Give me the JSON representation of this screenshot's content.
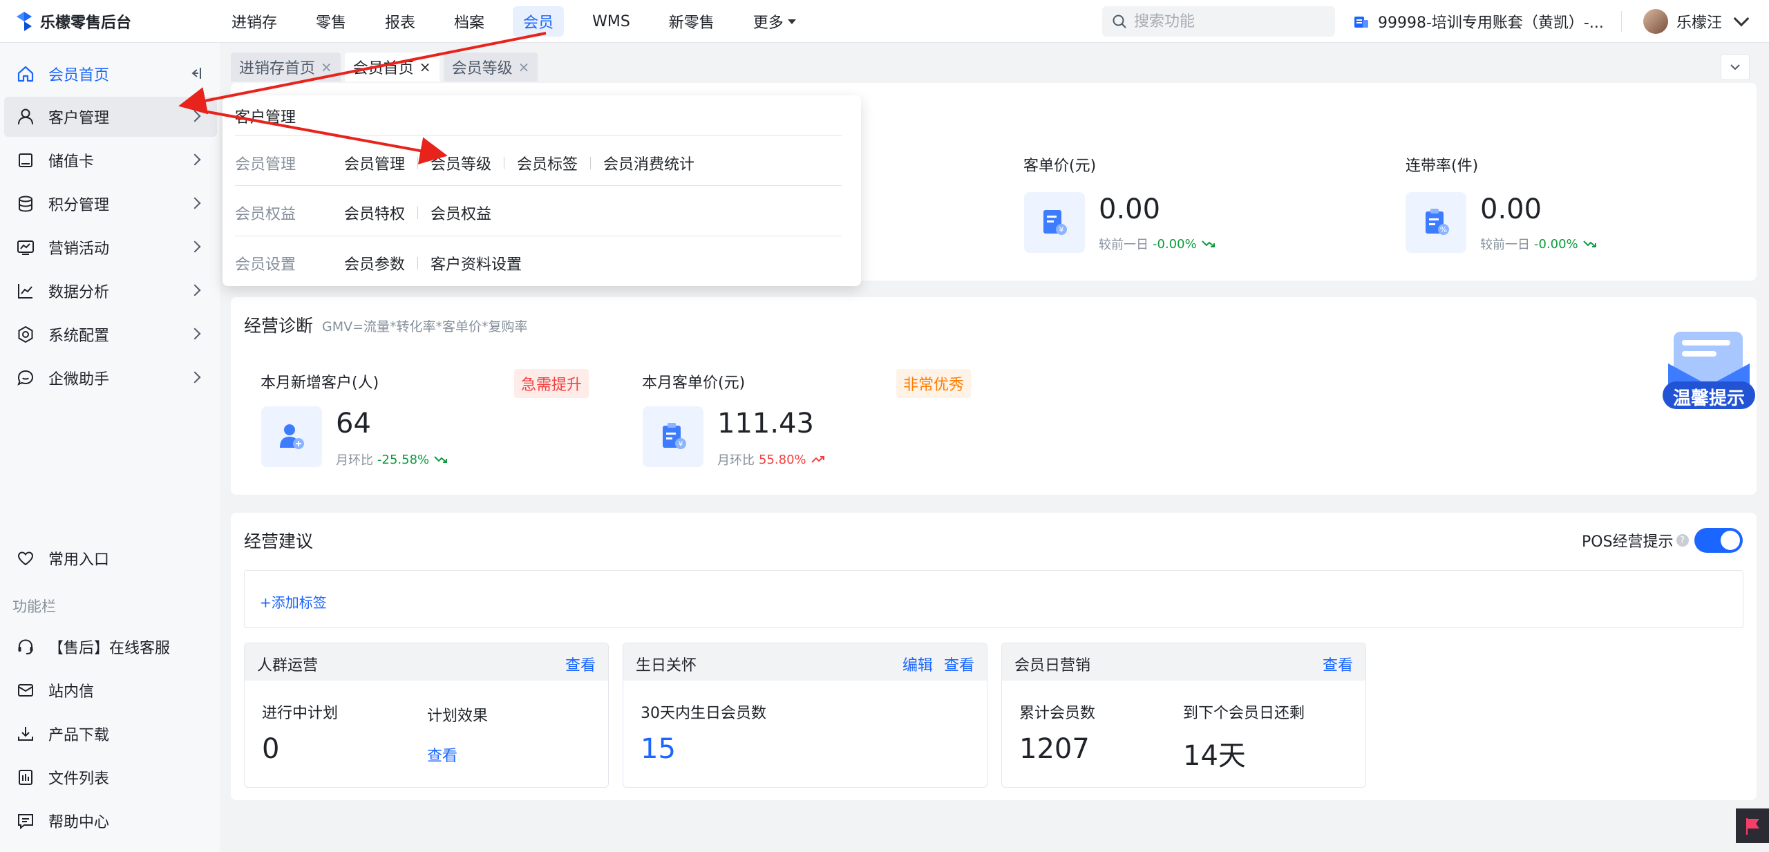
{
  "app": {
    "logo_text": "乐檬零售后台"
  },
  "nav": {
    "items": [
      {
        "label": "进销存",
        "active": false
      },
      {
        "label": "零售",
        "active": false
      },
      {
        "label": "报表",
        "active": false
      },
      {
        "label": "档案",
        "active": false
      },
      {
        "label": "会员",
        "active": true
      },
      {
        "label": "WMS",
        "active": false
      },
      {
        "label": "新零售",
        "active": false
      },
      {
        "label": "更多",
        "active": false
      }
    ]
  },
  "search": {
    "placeholder": "搜索功能"
  },
  "account": {
    "label": "99998-培训专用账套（黄凯）-..."
  },
  "user": {
    "name": "乐檬汪"
  },
  "sidebar": {
    "items": [
      {
        "label": "会员首页"
      },
      {
        "label": "客户管理"
      },
      {
        "label": "储值卡"
      },
      {
        "label": "积分管理"
      },
      {
        "label": "营销活动"
      },
      {
        "label": "数据分析"
      },
      {
        "label": "系统配置"
      },
      {
        "label": "企微助手"
      }
    ],
    "favorites": "常用入口",
    "section_label": "功能栏",
    "tools": [
      {
        "label": "【售后】在线客服"
      },
      {
        "label": "站内信"
      },
      {
        "label": "产品下载"
      },
      {
        "label": "文件列表"
      },
      {
        "label": "帮助中心"
      }
    ]
  },
  "tabs": [
    {
      "label": "进销存首页",
      "close": "×"
    },
    {
      "label": "会员首页",
      "close": "×"
    },
    {
      "label": "会员等级",
      "close": "×"
    }
  ],
  "kpis": [
    {
      "label": "客单价(元)",
      "value": "0.00",
      "compare_label": "较前一日",
      "change": "-0.00%"
    },
    {
      "label": "连带率(件)",
      "value": "0.00",
      "compare_label": "较前一日",
      "change": "-0.00%"
    }
  ],
  "diagnosis": {
    "title": "经营诊断",
    "formula": "GMV=流量*转化率*客单价*复购率",
    "metrics": [
      {
        "label": "本月新增客户(人)",
        "badge": "急需提升",
        "value": "64",
        "compare_label": "月环比",
        "change": "-25.58%"
      },
      {
        "label": "本月客单价(元)",
        "badge": "非常优秀",
        "value": "111.43",
        "compare_label": "月环比",
        "change": "55.80%"
      }
    ]
  },
  "advice": {
    "title": "经营建议",
    "pos_tip_label": "POS经营提示",
    "help": "?",
    "add_tag": "+添加标签",
    "cards": [
      {
        "title": "人群运营",
        "link": "查看",
        "fields": [
          {
            "label": "进行中计划",
            "value": "0"
          },
          {
            "label": "计划效果",
            "link": "查看"
          }
        ]
      },
      {
        "title": "生日关怀",
        "edit": "编辑",
        "link": "查看",
        "fields": [
          {
            "label": "30天内生日会员数",
            "value": "15"
          }
        ]
      },
      {
        "title": "会员日营销",
        "link": "查看",
        "fields": [
          {
            "label": "累计会员数",
            "value": "1207"
          },
          {
            "label": "到下个会员日还剩",
            "value": "14天"
          }
        ]
      }
    ]
  },
  "dropdown": {
    "title": "客户管理",
    "groups": [
      {
        "category": "会员管理",
        "links": [
          "会员管理",
          "会员等级",
          "会员标签",
          "会员消费统计"
        ]
      },
      {
        "category": "会员权益",
        "links": [
          "会员特权",
          "会员权益"
        ]
      },
      {
        "category": "会员设置",
        "links": [
          "会员参数",
          "客户资料设置"
        ]
      }
    ]
  },
  "float_tip": {
    "label": "温馨提示"
  },
  "colors": {
    "accent": "#1a66ff",
    "annotation": "#e8231c",
    "positive": "#0d9b3d",
    "negative": "#f53f3f"
  }
}
